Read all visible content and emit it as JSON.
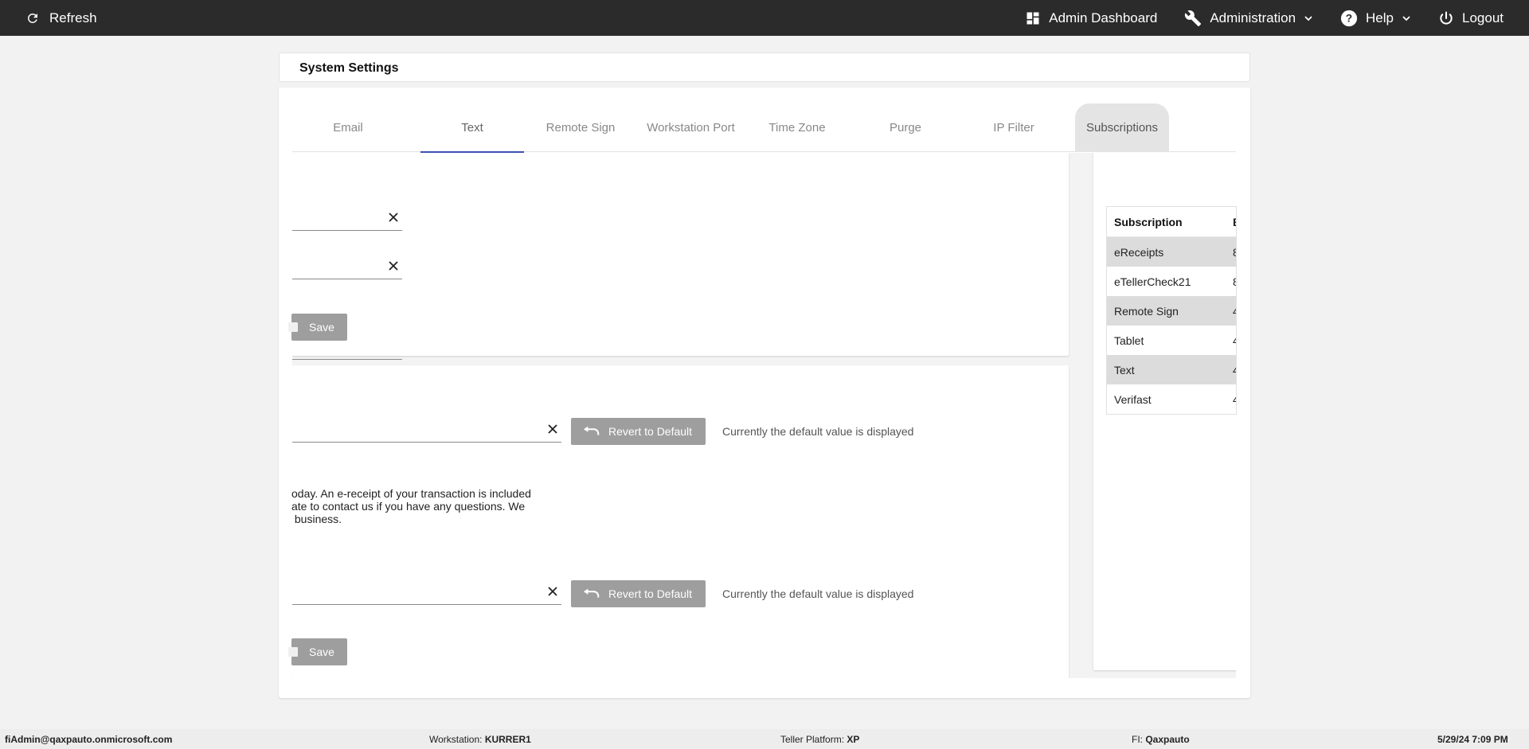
{
  "topbar": {
    "refresh_label": "Refresh",
    "admin_dashboard_label": "Admin Dashboard",
    "administration_label": "Administration",
    "help_label": "Help",
    "logout_label": "Logout"
  },
  "page_title": "System Settings",
  "tabs": [
    {
      "label": "Email"
    },
    {
      "label": "Text"
    },
    {
      "label": "Remote Sign"
    },
    {
      "label": "Workstation Port"
    },
    {
      "label": "Time Zone"
    },
    {
      "label": "Purge"
    },
    {
      "label": "IP Filter"
    },
    {
      "label": "Subscriptions"
    }
  ],
  "active_tab": "Text",
  "panel1": {
    "save_label": "Save"
  },
  "panel2": {
    "revert_label": "Revert to Default",
    "default_note": "Currently the default value is displayed",
    "message_text": "oday. An e-receipt of your transaction is included\nate to contact us if you have any questions. We\n business.",
    "save_label": "Save"
  },
  "subscriptions": {
    "header": "Subscription",
    "header_cut": "E",
    "rows": [
      {
        "name": "eReceipts",
        "cut": "8"
      },
      {
        "name": "eTellerCheck21",
        "cut": "8"
      },
      {
        "name": "Remote Sign",
        "cut": "4"
      },
      {
        "name": "Tablet",
        "cut": "4"
      },
      {
        "name": "Text",
        "cut": "4"
      },
      {
        "name": "Verifast",
        "cut": "4"
      }
    ]
  },
  "footer": {
    "user": "fiAdmin@qaxpauto.onmicrosoft.com",
    "workstation_label": "Workstation:",
    "workstation_value": "KURRER1",
    "platform_label": "Teller Platform:",
    "platform_value": "XP",
    "fi_label": "FI:",
    "fi_value": "Qaxpauto",
    "datetime": "5/29/24 7:09 PM"
  },
  "colors": {
    "topbar": "#2b2b2b",
    "tab_indicator": "#3f51b5",
    "button": "#9e9e9e"
  }
}
